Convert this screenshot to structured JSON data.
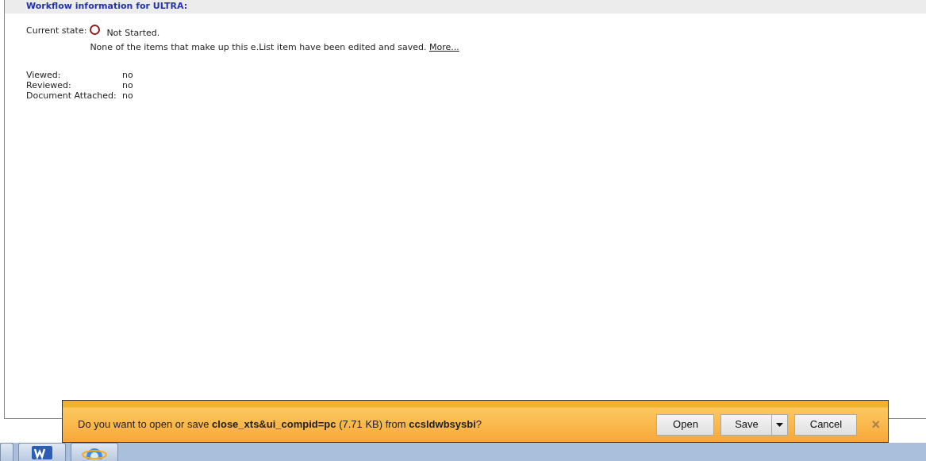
{
  "header": {
    "title": "Workflow information for ULTRA:"
  },
  "state": {
    "label": "Current state:",
    "value": "Not Started.",
    "description": "None of the items that make up this e.List item have been edited and saved.",
    "link": "More..."
  },
  "properties": [
    {
      "label": "Viewed:",
      "value": "no"
    },
    {
      "label": "Reviewed:",
      "value": "no"
    },
    {
      "label": "Document Attached:",
      "value": "no"
    }
  ],
  "notification": {
    "message": "Do you want to open or save **close_xts&ui_compid=pc** (7.71 KB) from **ccsldwbsysbi**?",
    "buttons": [
      {
        "label": "Open",
        "kind": "plain"
      },
      {
        "label": "Save",
        "kind": "split"
      },
      {
        "label": "Cancel",
        "kind": "plain"
      }
    ],
    "close": "×"
  },
  "taskbar": [
    {
      "kind": "word"
    },
    {
      "kind": "ie"
    }
  ]
}
